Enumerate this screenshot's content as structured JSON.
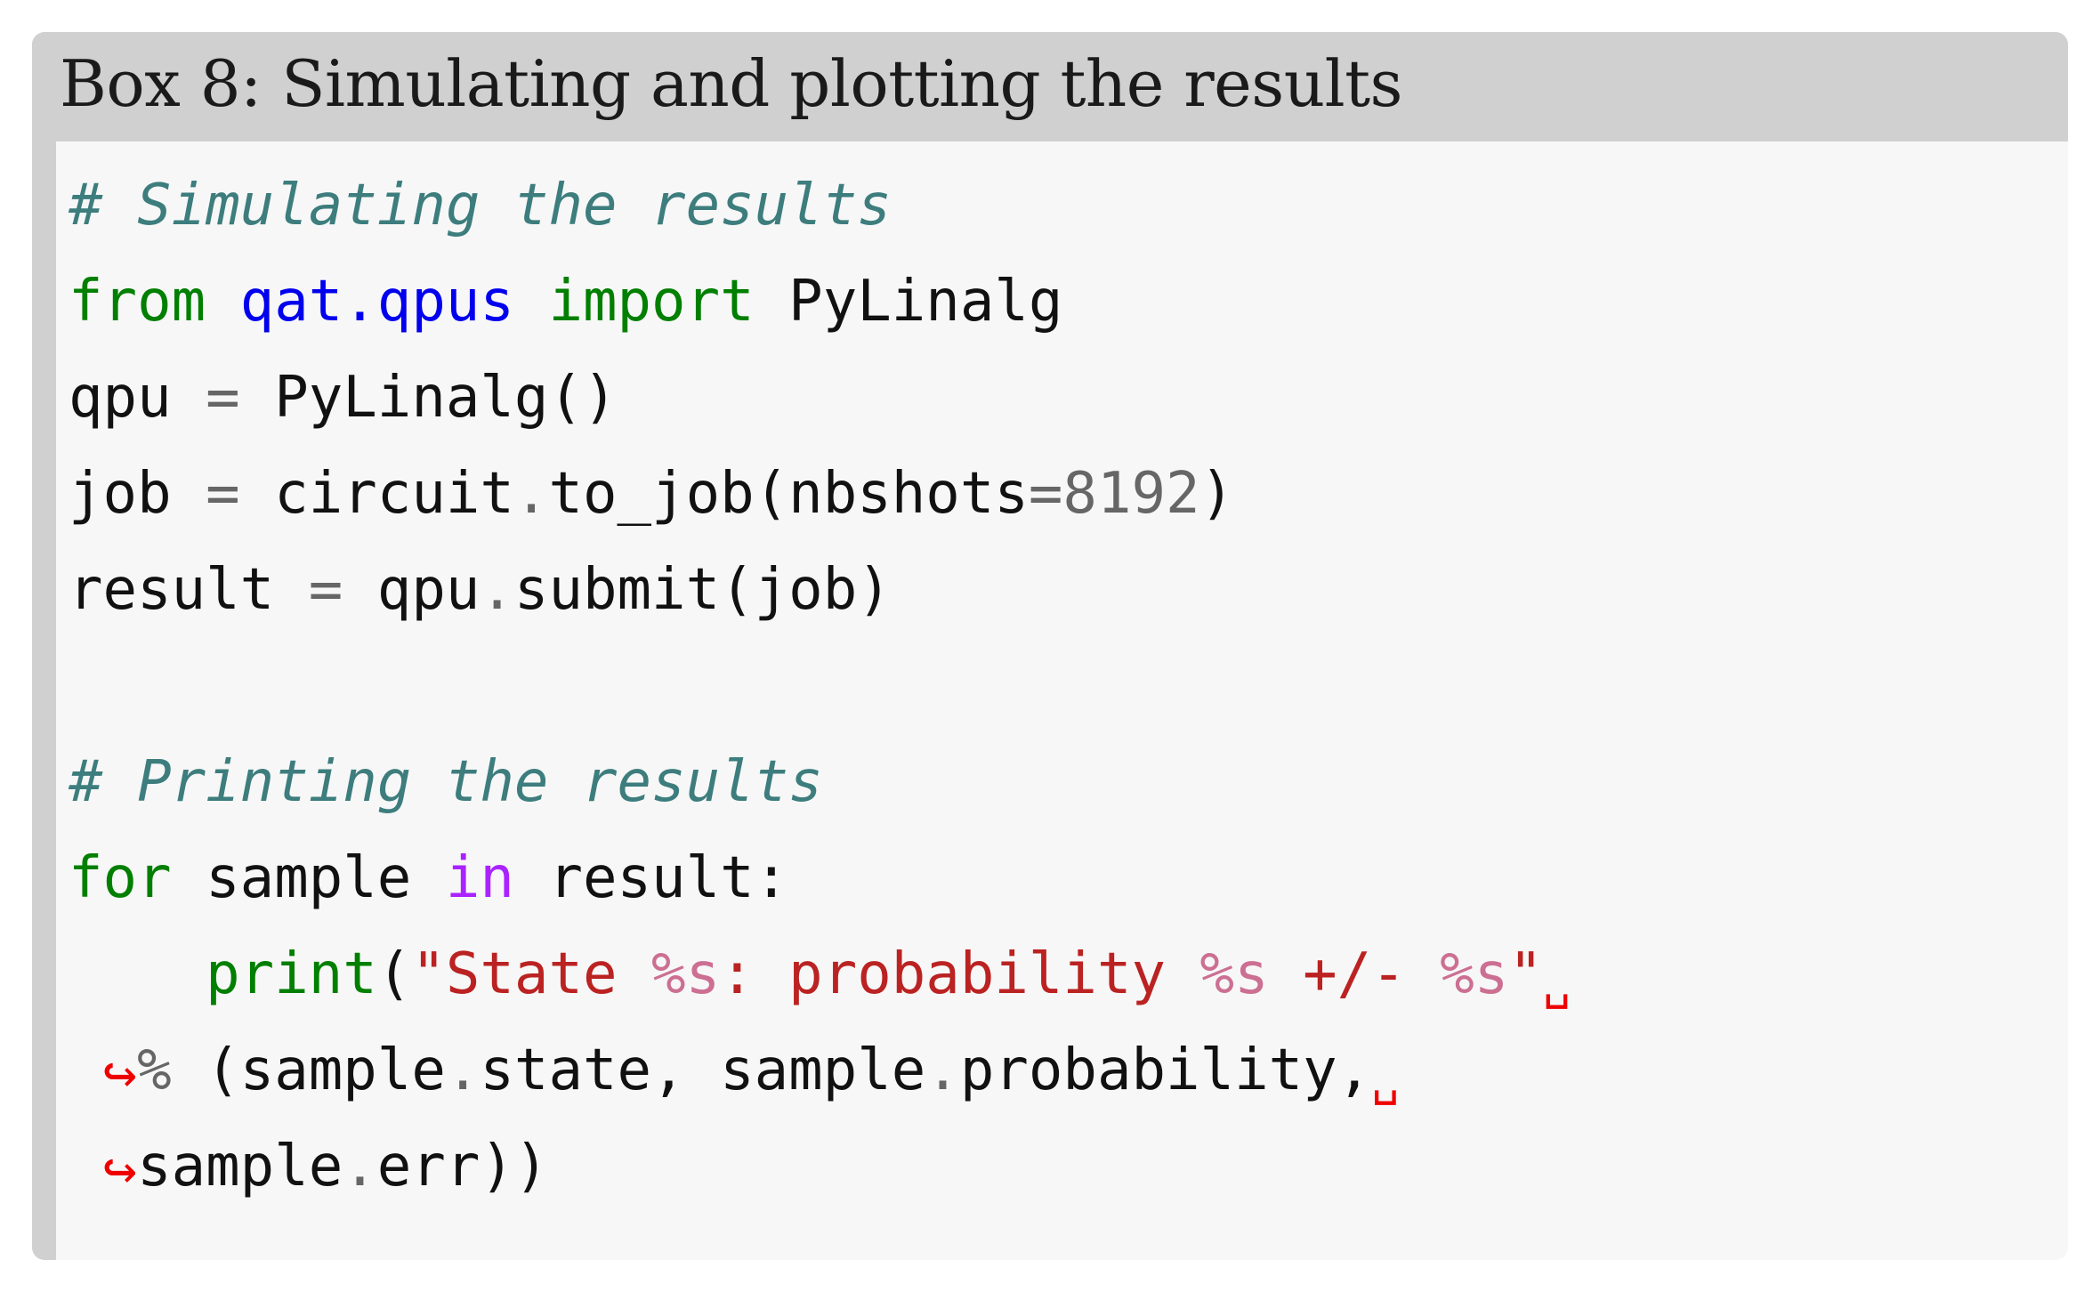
{
  "box": {
    "title": "Box 8: Simulating and plotting the results",
    "header_bg": "#d0d0d0",
    "body_bg": "#f7f7f7",
    "rail_bg": "#d0d0d0"
  },
  "colors": {
    "comment": "#3d7d7d",
    "keyword": "#007f00",
    "module": "#0000ee",
    "number": "#666666",
    "operator": "#666666",
    "string": "#bb2222",
    "format_spec": "#cc6f92",
    "builtin": "#007f00",
    "magic_in": "#aa22ff",
    "plain": "#111111",
    "wrap_marker": "#ee0000",
    "cont_marker": "#ee0000"
  },
  "code": {
    "line_1": {
      "t1": "# Simulating the results"
    },
    "line_2": {
      "t1": "from",
      "t2": " ",
      "t3": "qat.qpus",
      "t4": " ",
      "t5": "import",
      "t6": " PyLinalg"
    },
    "line_3": {
      "t1": "qpu ",
      "t2": "=",
      "t3": " PyLinalg()"
    },
    "line_4": {
      "t1": "job ",
      "t2": "=",
      "t3": " circuit",
      "t4": ".",
      "t5": "to_job(nbshots",
      "t6": "=",
      "t7": "8192",
      "t8": ")"
    },
    "line_5": {
      "t1": "result ",
      "t2": "=",
      "t3": " qpu",
      "t4": ".",
      "t5": "submit(job)"
    },
    "line_6": {
      "t1": ""
    },
    "line_7": {
      "t1": "# Printing the results"
    },
    "line_8": {
      "t1": "for",
      "t2": " sample ",
      "t3": "in",
      "t4": " result:"
    },
    "line_9": {
      "t1": "    ",
      "t2": "print",
      "t3": "(",
      "t4": "\"State ",
      "t5": "%s",
      "t6": ": probability ",
      "t7": "%s",
      "t8": " +/- ",
      "t9": "%s",
      "t10": "\"",
      "t11": "␣"
    },
    "line_10": {
      "t1": " ",
      "t2": "↪",
      "t3": "%",
      "t4": " (sample",
      "t5": ".",
      "t6": "state, sample",
      "t7": ".",
      "t8": "probability,",
      "t9": "␣"
    },
    "line_11": {
      "t1": " ",
      "t2": "↪",
      "t3": "sample",
      "t4": ".",
      "t5": "err))"
    }
  }
}
